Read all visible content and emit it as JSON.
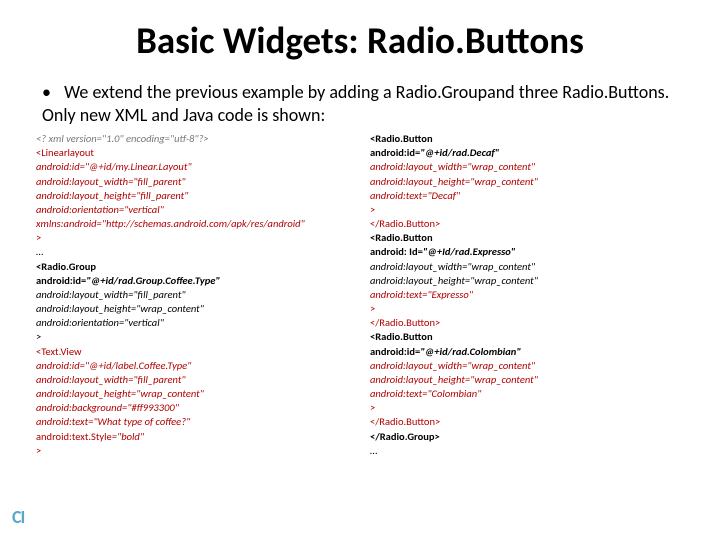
{
  "title": "Basic Widgets: Radio.Buttons",
  "bullet": "We extend the previous example by adding a Radio.Groupand three Radio.Buttons. Only new XML and Java code is shown:",
  "col1": {
    "l1": "<? xml version=\"1.0\" encoding=\"utf-8\"?>",
    "l2": "<Linearlayout",
    "l3": "android:id=\"@+id/my.Linear.Layout\"",
    "l4": "android:layout_width=\"fill_parent\"",
    "l5": "android:layout_height=\"fill_parent\"",
    "l6": "android:orientation=\"vertical\"",
    "l7": "xmlns:android=\"http://schemas.android.com/apk/res/android\"",
    "l8": ">",
    "l9": "…",
    "l10": "<Radio.Group",
    "l11a": "android:id=",
    "l11b": "\"@+id/rad.Group.Coffee.Type\"",
    "l12": "android:layout_width=\"fill_parent\"",
    "l13": "android:layout_height=\"wrap_content\"",
    "l14": "android:orientation=\"vertical\"",
    "l15": ">",
    "l16": "<Text.View",
    "l17": "android:id=\"@+id/label.Coffee.Type\"",
    "l18": "android:layout_width=\"fill_parent\"",
    "l19": "android:layout_height=\"wrap_content\"",
    "l20": "android:background=\"#ff993300\"",
    "l21": "android:text=\"What type of coffee?\"",
    "l22a": "android:text.Style",
    "l22b": "=\"bold\"",
    "l23": ">"
  },
  "col2": {
    "l1": "<Radio.Button",
    "l2a": "android:id=",
    "l2b": "\"@+id/rad.Decaf\"",
    "l3": "android:layout_width=\"wrap_content\"",
    "l4": "android:layout_height=\"wrap_content\"",
    "l5": "android:text=\"Decaf\"",
    "l6": ">",
    "l7": "</Radio.Button>",
    "l8": "<Radio.Button",
    "l9a": "android: Id=",
    "l9b": "\"@+Id/rad.Expresso\"",
    "l10": "android:layout_width=\"wrap_content\"",
    "l11": "android:layout_height=\"wrap_content\"",
    "l12": "android:text=\"Expresso\"",
    "l13": ">",
    "l14": "</Radio.Button>",
    "l15": "<Radio.Button",
    "l16a": "android:id=",
    "l16b": "\"@+id/rad.Colombian\"",
    "l17": "android:layout_width=\"wrap_content\"",
    "l18": "android:layout_height=\"wrap_content\"",
    "l19": "android:text=\"Colombian\"",
    "l20": ">",
    "l21": "</Radio.Button>",
    "l22": "</Radio.Group>",
    "l23": "…"
  },
  "logo": "CI"
}
